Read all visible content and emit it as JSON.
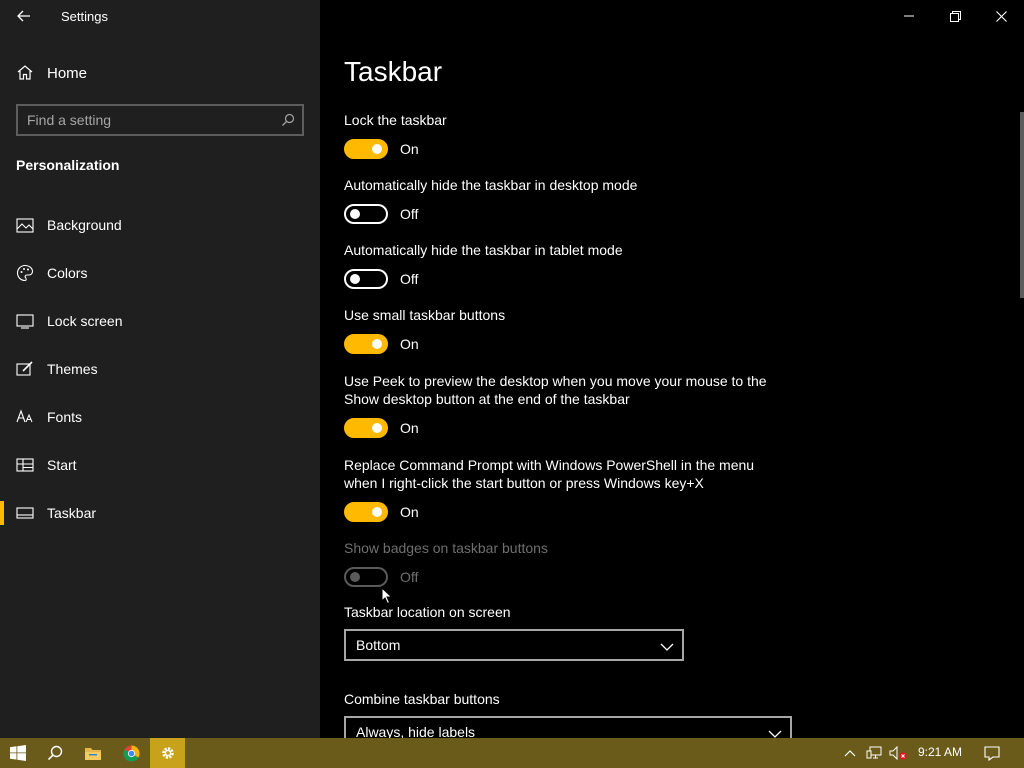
{
  "window": {
    "title": "Settings"
  },
  "sidebar": {
    "home_label": "Home",
    "search_placeholder": "Find a setting",
    "section_title": "Personalization",
    "items": [
      {
        "label": "Background",
        "icon": "picture-icon"
      },
      {
        "label": "Colors",
        "icon": "palette-icon"
      },
      {
        "label": "Lock screen",
        "icon": "lock-screen-icon"
      },
      {
        "label": "Themes",
        "icon": "brush-icon"
      },
      {
        "label": "Fonts",
        "icon": "font-icon"
      },
      {
        "label": "Start",
        "icon": "start-layout-icon"
      },
      {
        "label": "Taskbar",
        "icon": "taskbar-icon",
        "active": true
      }
    ]
  },
  "main": {
    "title": "Taskbar",
    "settings": [
      {
        "label": "Lock the taskbar",
        "state": "On",
        "on": true,
        "disabled": false
      },
      {
        "label": "Automatically hide the taskbar in desktop mode",
        "state": "Off",
        "on": false,
        "disabled": false
      },
      {
        "label": "Automatically hide the taskbar in tablet mode",
        "state": "Off",
        "on": false,
        "disabled": false
      },
      {
        "label": "Use small taskbar buttons",
        "state": "On",
        "on": true,
        "disabled": false
      },
      {
        "label": "Use Peek to preview the desktop when you move your mouse to the Show desktop button at the end of the taskbar",
        "state": "On",
        "on": true,
        "disabled": false
      },
      {
        "label": "Replace Command Prompt with Windows PowerShell in the menu when I right-click the start button or press Windows key+X",
        "state": "On",
        "on": true,
        "disabled": false
      },
      {
        "label": "Show badges on taskbar buttons",
        "state": "Off",
        "on": false,
        "disabled": true
      }
    ],
    "location": {
      "label": "Taskbar location on screen",
      "value": "Bottom"
    },
    "combine": {
      "label": "Combine taskbar buttons",
      "value": "Always, hide labels"
    }
  },
  "taskbar": {
    "time": "9:21 AM"
  },
  "colors": {
    "accent": "#ffb900",
    "sidebar_bg": "#1f1f1f",
    "main_bg": "#000000",
    "taskbar_bg": "#6b5b1a"
  }
}
